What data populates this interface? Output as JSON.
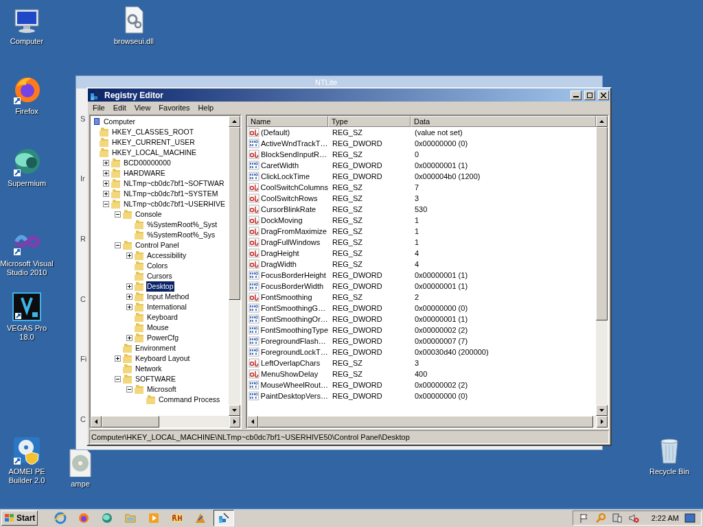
{
  "desktop_icons": [
    {
      "label": "Computer",
      "kind": "computer"
    },
    {
      "label": "browseui.dll",
      "kind": "dll"
    },
    {
      "label": "Firefox",
      "kind": "firefox"
    },
    {
      "label": "Supermium",
      "kind": "supermium"
    },
    {
      "label": "Microsoft Visual Studio 2010",
      "kind": "visualstudio"
    },
    {
      "label": "VEGAS Pro 18.0",
      "kind": "vegas"
    },
    {
      "label": "AOMEI PE Builder 2.0",
      "kind": "aomei"
    },
    {
      "label": "ampe",
      "kind": "disc"
    },
    {
      "label": "Recycle Bin",
      "kind": "recycle"
    }
  ],
  "background_window": {
    "title": "NTLite",
    "side_labels": [
      "S",
      "Ir",
      "R",
      "C",
      "Fi",
      "C"
    ]
  },
  "registry_editor": {
    "title": "Registry Editor",
    "menu": [
      "File",
      "Edit",
      "View",
      "Favorites",
      "Help"
    ],
    "tree": [
      {
        "label": "Computer",
        "kind": "computer",
        "selected": false,
        "children": [
          {
            "label": "HKEY_CLASSES_ROOT",
            "selected": false
          },
          {
            "label": "HKEY_CURRENT_USER",
            "selected": false
          },
          {
            "label": "HKEY_LOCAL_MACHINE",
            "selected": false,
            "children": [
              {
                "label": "BCD00000000",
                "selected": false,
                "expanded": false
              },
              {
                "label": "HARDWARE",
                "selected": false,
                "expanded": false
              },
              {
                "label": "NLTmp~cb0dc7bf1~SOFTWAR",
                "selected": false,
                "expanded": false
              },
              {
                "label": "NLTmp~cb0dc7bf1~SYSTEM",
                "selected": false,
                "expanded": false
              },
              {
                "label": "NLTmp~cb0dc7bf1~USERHIVE",
                "selected": false,
                "expanded": true,
                "children": [
                  {
                    "label": "Console",
                    "selected": false,
                    "expanded": true,
                    "children": [
                      {
                        "label": "%SystemRoot%_Syst",
                        "selected": false
                      },
                      {
                        "label": "%SystemRoot%_Sys",
                        "selected": false
                      }
                    ]
                  },
                  {
                    "label": "Control Panel",
                    "selected": false,
                    "expanded": true,
                    "children": [
                      {
                        "label": "Accessibility",
                        "selected": false,
                        "expanded": false
                      },
                      {
                        "label": "Colors",
                        "selected": false
                      },
                      {
                        "label": "Cursors",
                        "selected": false
                      },
                      {
                        "label": "Desktop",
                        "selected": true,
                        "expanded": false
                      },
                      {
                        "label": "Input Method",
                        "selected": false,
                        "expanded": false
                      },
                      {
                        "label": "International",
                        "selected": false,
                        "expanded": false
                      },
                      {
                        "label": "Keyboard",
                        "selected": false
                      },
                      {
                        "label": "Mouse",
                        "selected": false
                      },
                      {
                        "label": "PowerCfg",
                        "selected": false,
                        "expanded": false
                      }
                    ]
                  },
                  {
                    "label": "Environment",
                    "selected": false
                  },
                  {
                    "label": "Keyboard Layout",
                    "selected": false,
                    "expanded": false
                  },
                  {
                    "label": "Network",
                    "selected": false
                  },
                  {
                    "label": "SOFTWARE",
                    "selected": false,
                    "expanded": true,
                    "children": [
                      {
                        "label": "Microsoft",
                        "selected": false,
                        "expanded": true,
                        "children": [
                          {
                            "label": "Command Process",
                            "selected": false
                          }
                        ]
                      }
                    ]
                  }
                ]
              }
            ]
          }
        ]
      }
    ],
    "columns": [
      "Name",
      "Type",
      "Data"
    ],
    "rows": [
      {
        "name": "(Default)",
        "type": "REG_SZ",
        "data": "(value not set)",
        "kind": "sz"
      },
      {
        "name": "ActiveWndTrackT…",
        "type": "REG_DWORD",
        "data": "0x00000000 (0)",
        "kind": "dword"
      },
      {
        "name": "BlockSendInputR…",
        "type": "REG_SZ",
        "data": "0",
        "kind": "sz"
      },
      {
        "name": "CaretWidth",
        "type": "REG_DWORD",
        "data": "0x00000001 (1)",
        "kind": "dword"
      },
      {
        "name": "ClickLockTime",
        "type": "REG_DWORD",
        "data": "0x000004b0 (1200)",
        "kind": "dword"
      },
      {
        "name": "CoolSwitchColumns",
        "type": "REG_SZ",
        "data": "7",
        "kind": "sz"
      },
      {
        "name": "CoolSwitchRows",
        "type": "REG_SZ",
        "data": "3",
        "kind": "sz"
      },
      {
        "name": "CursorBlinkRate",
        "type": "REG_SZ",
        "data": "530",
        "kind": "sz"
      },
      {
        "name": "DockMoving",
        "type": "REG_SZ",
        "data": "1",
        "kind": "sz"
      },
      {
        "name": "DragFromMaximize",
        "type": "REG_SZ",
        "data": "1",
        "kind": "sz"
      },
      {
        "name": "DragFullWindows",
        "type": "REG_SZ",
        "data": "1",
        "kind": "sz"
      },
      {
        "name": "DragHeight",
        "type": "REG_SZ",
        "data": "4",
        "kind": "sz"
      },
      {
        "name": "DragWidth",
        "type": "REG_SZ",
        "data": "4",
        "kind": "sz"
      },
      {
        "name": "FocusBorderHeight",
        "type": "REG_DWORD",
        "data": "0x00000001 (1)",
        "kind": "dword"
      },
      {
        "name": "FocusBorderWidth",
        "type": "REG_DWORD",
        "data": "0x00000001 (1)",
        "kind": "dword"
      },
      {
        "name": "FontSmoothing",
        "type": "REG_SZ",
        "data": "2",
        "kind": "sz"
      },
      {
        "name": "FontSmoothingG…",
        "type": "REG_DWORD",
        "data": "0x00000000 (0)",
        "kind": "dword"
      },
      {
        "name": "FontSmoothingOr…",
        "type": "REG_DWORD",
        "data": "0x00000001 (1)",
        "kind": "dword"
      },
      {
        "name": "FontSmoothingType",
        "type": "REG_DWORD",
        "data": "0x00000002 (2)",
        "kind": "dword"
      },
      {
        "name": "ForegroundFlash…",
        "type": "REG_DWORD",
        "data": "0x00000007 (7)",
        "kind": "dword"
      },
      {
        "name": "ForegroundLockT…",
        "type": "REG_DWORD",
        "data": "0x00030d40 (200000)",
        "kind": "dword"
      },
      {
        "name": "LeftOverlapChars",
        "type": "REG_SZ",
        "data": "3",
        "kind": "sz"
      },
      {
        "name": "MenuShowDelay",
        "type": "REG_SZ",
        "data": "400",
        "kind": "sz"
      },
      {
        "name": "MouseWheelRout…",
        "type": "REG_DWORD",
        "data": "0x00000002 (2)",
        "kind": "dword"
      },
      {
        "name": "PaintDesktopVers…",
        "type": "REG_DWORD",
        "data": "0x00000000 (0)",
        "kind": "dword"
      }
    ],
    "status_path": "Computer\\HKEY_LOCAL_MACHINE\\NLTmp~cb0dc7bf1~USERHIVE50\\Control Panel\\Desktop"
  },
  "taskbar": {
    "start_label": "Start",
    "apps": [
      {
        "kind": "ie",
        "selected": false
      },
      {
        "kind": "firefox",
        "selected": false
      },
      {
        "kind": "supermium",
        "selected": false
      },
      {
        "kind": "folder",
        "selected": false
      },
      {
        "kind": "media",
        "selected": false
      },
      {
        "kind": "rh",
        "selected": false
      },
      {
        "kind": "paint",
        "selected": false
      },
      {
        "kind": "regedit",
        "selected": true
      }
    ],
    "clock": "2:22 AM"
  }
}
